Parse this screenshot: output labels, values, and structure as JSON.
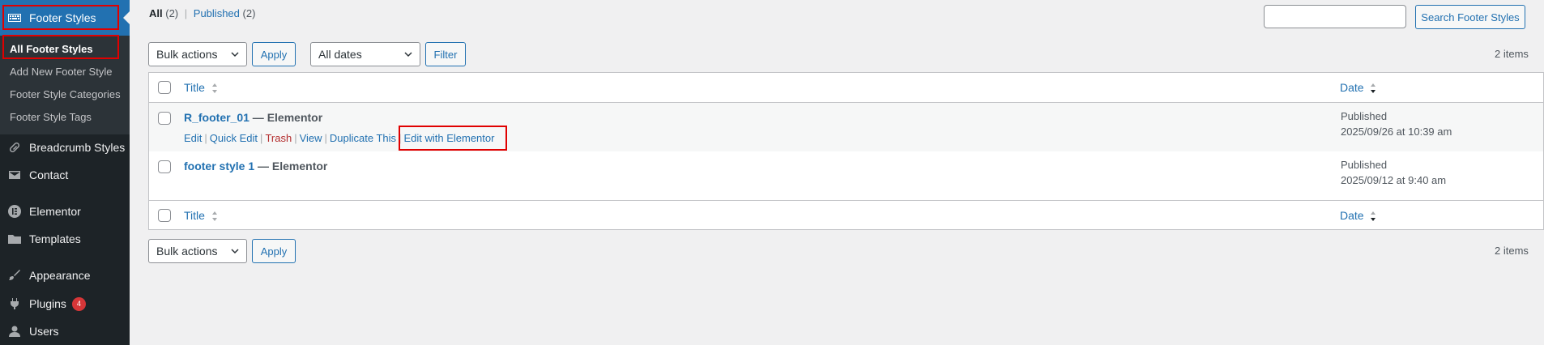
{
  "sidebar": {
    "active_menu": "Footer Styles",
    "submenu": [
      "All Footer Styles",
      "Add New Footer Style",
      "Footer Style Categories",
      "Footer Style Tags"
    ],
    "items": [
      {
        "label": "Breadcrumb Styles",
        "icon": "link-icon"
      },
      {
        "label": "Contact",
        "icon": "mail-icon"
      },
      {
        "label": "Elementor",
        "icon": "elementor-icon"
      },
      {
        "label": "Templates",
        "icon": "folder-icon"
      },
      {
        "label": "Appearance",
        "icon": "paintbrush-icon"
      },
      {
        "label": "Plugins",
        "icon": "plugin-icon",
        "badge": "4"
      },
      {
        "label": "Users",
        "icon": "user-icon"
      }
    ]
  },
  "views": {
    "all_label": "All",
    "all_count": "(2)",
    "published_label": "Published",
    "published_count": "(2)"
  },
  "search": {
    "button_label": "Search Footer Styles",
    "value": ""
  },
  "toolbar": {
    "bulk_actions": "Bulk actions",
    "apply": "Apply",
    "dates": "All dates",
    "filter": "Filter",
    "items_count": "2 items"
  },
  "table": {
    "col_title": "Title",
    "col_date": "Date",
    "rows": [
      {
        "title": "R_footer_01",
        "state": " — Elementor",
        "actions": [
          "Edit",
          "Quick Edit",
          "Trash",
          "View",
          "Duplicate This",
          "Edit with Elementor"
        ],
        "status": "Published",
        "date": "2025/09/26 at 10:39 am"
      },
      {
        "title": "footer style 1",
        "state": " — Elementor",
        "status": "Published",
        "date": "2025/09/12 at 9:40 am"
      }
    ]
  },
  "colors": {
    "accent": "#2271b1",
    "sidebar_bg": "#1d2327",
    "highlight": "#e00000",
    "trash": "#b32d2e"
  }
}
